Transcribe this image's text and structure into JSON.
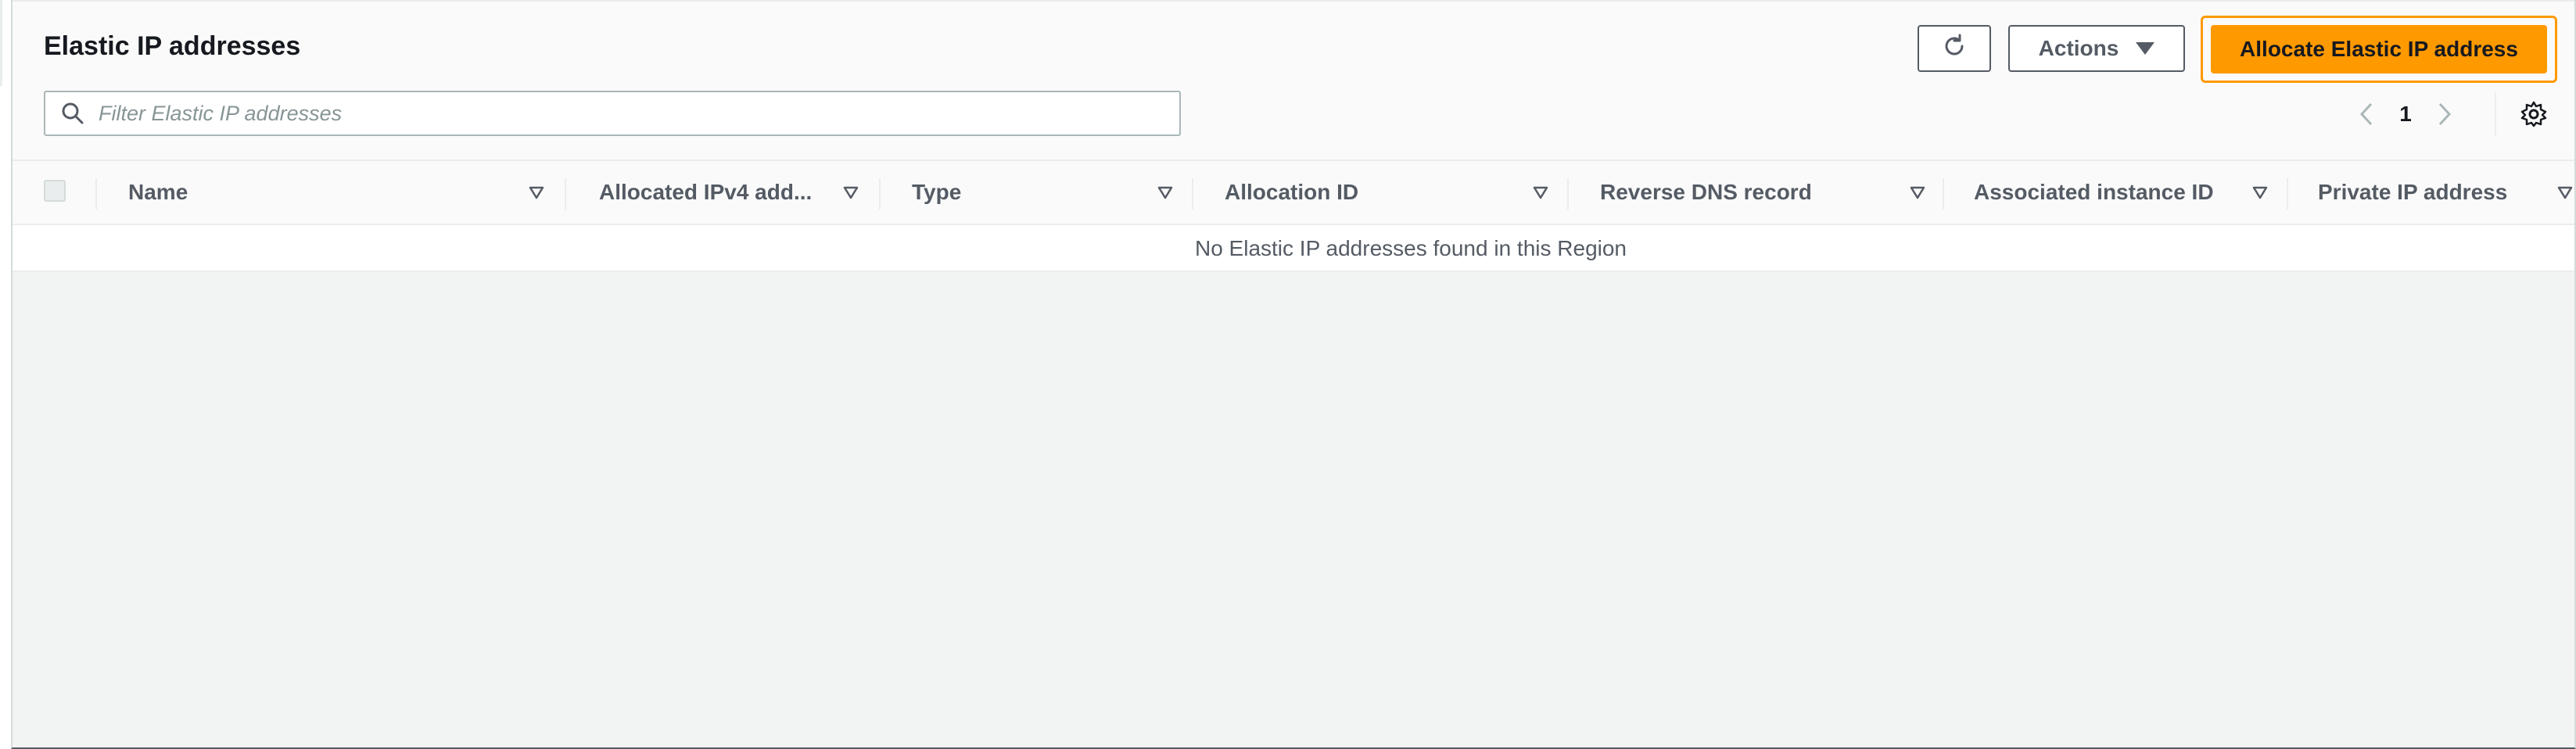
{
  "header": {
    "title": "Elastic IP addresses",
    "refresh_icon": "refresh-icon",
    "actions_label": "Actions",
    "primary_label": "Allocate Elastic IP address"
  },
  "search": {
    "placeholder": "Filter Elastic IP addresses",
    "value": ""
  },
  "pagination": {
    "current_page": "1"
  },
  "table": {
    "columns": [
      {
        "label": "Name"
      },
      {
        "label": "Allocated IPv4 add..."
      },
      {
        "label": "Type"
      },
      {
        "label": "Allocation ID"
      },
      {
        "label": "Reverse DNS record"
      },
      {
        "label": "Associated instance ID"
      },
      {
        "label": "Private IP address"
      }
    ],
    "empty_message": "No Elastic IP addresses found in this Region"
  },
  "colors": {
    "primary": "#ff9900",
    "text_secondary": "#545b64"
  }
}
